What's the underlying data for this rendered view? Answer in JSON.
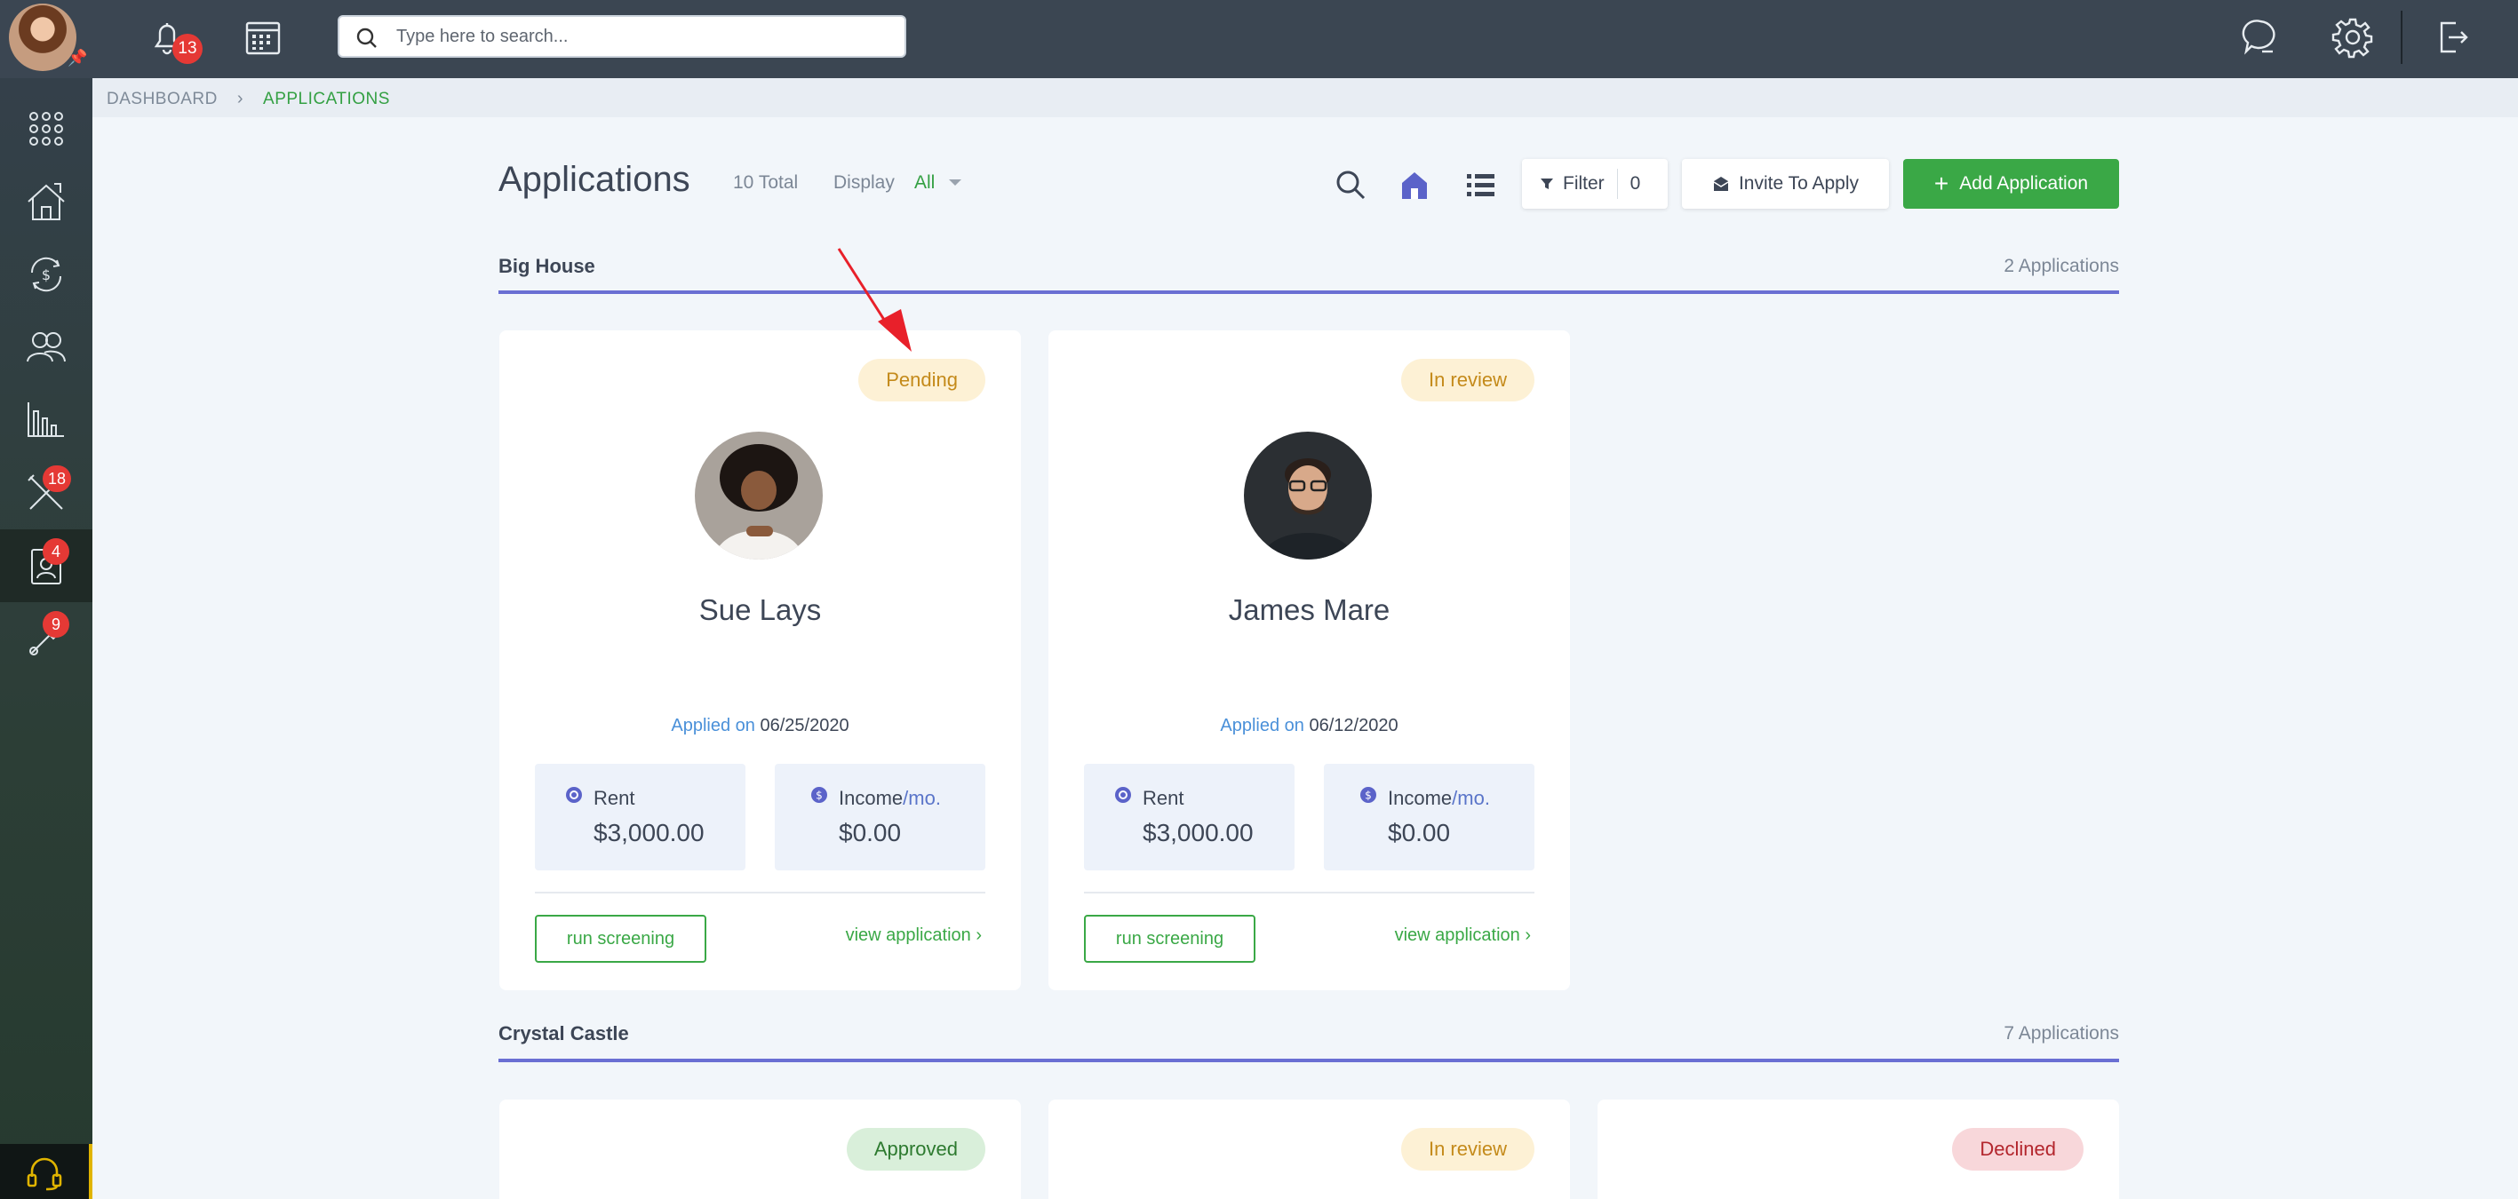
{
  "topbar": {
    "notifications_count": "13",
    "search_placeholder": "Type here to search..."
  },
  "sidebar": {
    "items": [
      {
        "icon": "apps-grid-icon"
      },
      {
        "icon": "properties-icon"
      },
      {
        "icon": "payments-icon"
      },
      {
        "icon": "people-icon"
      },
      {
        "icon": "reports-icon"
      },
      {
        "icon": "maintenance-icon",
        "badge": "18"
      },
      {
        "icon": "applications-icon",
        "badge": "4",
        "active": true
      },
      {
        "icon": "tools-icon",
        "badge": "9"
      }
    ],
    "help_icon": "headset-icon"
  },
  "breadcrumb": {
    "root": "DASHBOARD",
    "current": "APPLICATIONS"
  },
  "header": {
    "title": "Applications",
    "total": "10 Total",
    "display_label": "Display",
    "display_value": "All",
    "filter_label": "Filter",
    "filter_count": "0",
    "invite_label": "Invite To Apply",
    "add_label": "Add Application"
  },
  "sections": [
    {
      "name": "Big House",
      "count": "2 Applications",
      "cards": [
        {
          "status": "Pending",
          "name": "Sue Lays",
          "applied_label": "Applied on",
          "applied_date": "06/25/2020",
          "rent_label": "Rent",
          "rent_value": "$3,000.00",
          "income_label": "Income",
          "income_per": "/mo.",
          "income_value": "$0.00",
          "run_label": "run screening",
          "view_label": "view application ›"
        },
        {
          "status": "In review",
          "name": "James Mare",
          "applied_label": "Applied on",
          "applied_date": "06/12/2020",
          "rent_label": "Rent",
          "rent_value": "$3,000.00",
          "income_label": "Income",
          "income_per": "/mo.",
          "income_value": "$0.00",
          "run_label": "run screening",
          "view_label": "view application ›"
        }
      ]
    },
    {
      "name": "Crystal Castle",
      "count": "7 Applications",
      "cards": [
        {
          "status": "Approved"
        },
        {
          "status": "In review"
        },
        {
          "status": "Declined"
        }
      ]
    }
  ],
  "colors": {
    "topbar": "#3b4652",
    "accent_green": "#3aa846",
    "section_line": "#6a6fd3",
    "annotation_arrow": "#e8202a"
  }
}
